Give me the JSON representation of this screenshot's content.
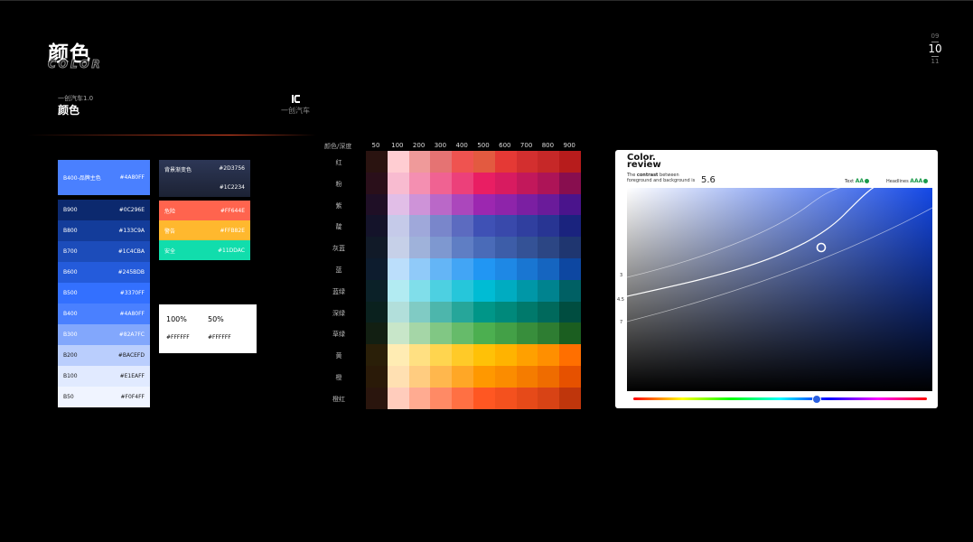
{
  "page": {
    "title_cn": "颜色",
    "title_en": "COLOR",
    "page_prev": "09",
    "page_current": "10",
    "page_next": "11"
  },
  "section": {
    "small_label": "一创汽车1.0",
    "big_label": "颜色",
    "logo_text": "一创汽车",
    "logo_icon": "ic-logo-mark"
  },
  "brand_swatch": {
    "name": "B400-品牌主色",
    "hex": "#4A80FF",
    "color": "#4A80FF"
  },
  "blue_scale": [
    {
      "name": "B900",
      "hex": "#0C296E",
      "color": "#0C296E"
    },
    {
      "name": "B800",
      "hex": "#133C9A",
      "color": "#133C9A"
    },
    {
      "name": "B700",
      "hex": "#1C4CBA",
      "color": "#1C4CBA"
    },
    {
      "name": "B600",
      "hex": "#245BDB",
      "color": "#245BDB"
    },
    {
      "name": "B500",
      "hex": "#3370FF",
      "color": "#3370FF"
    },
    {
      "name": "B400",
      "hex": "#4A80FF",
      "color": "#4A80FF"
    },
    {
      "name": "B300",
      "hex": "#82A7FC",
      "color": "#82A7FC"
    },
    {
      "name": "B200",
      "hex": "#BACEFD",
      "color": "#BACEFD"
    },
    {
      "name": "B100",
      "hex": "#E1EAFF",
      "color": "#E1EAFF"
    },
    {
      "name": "B50",
      "hex": "#F0F4FF",
      "color": "#F0F4FF"
    }
  ],
  "gradient_card": {
    "name": "背景渐变色",
    "hex_top": "#2D3756",
    "hex_bottom": "#1C2234"
  },
  "status_swatches": [
    {
      "name": "危险",
      "hex": "#FF644E",
      "color": "#FF644E"
    },
    {
      "name": "警告",
      "hex": "#FFB82E",
      "color": "#FFB82E"
    },
    {
      "name": "安全",
      "hex": "#11DDAC",
      "color": "#11DDAC"
    }
  ],
  "white_card": {
    "pct_a": "100%",
    "pct_b": "50%",
    "hex_a": "#FFFFFF",
    "hex_b": "#FFFFFF"
  },
  "palette": {
    "corner": "颜色/深度",
    "columns": [
      "50",
      "100",
      "200",
      "300",
      "400",
      "500",
      "600",
      "700",
      "800",
      "900"
    ],
    "rows": [
      {
        "name": "红",
        "colors": [
          "#2a1310",
          "#FFCDD2",
          "#EF9A9A",
          "#E57373",
          "#EF5350",
          "#E35A40",
          "#E53935",
          "#D32F2F",
          "#C62828",
          "#B71C1C"
        ]
      },
      {
        "name": "粉",
        "colors": [
          "#2a0f1a",
          "#F8BBD0",
          "#F48FB1",
          "#F06292",
          "#EC407A",
          "#E91E63",
          "#D81B60",
          "#C2185B",
          "#AD1457",
          "#880E4F"
        ]
      },
      {
        "name": "紫",
        "colors": [
          "#1f0f26",
          "#E1BEE7",
          "#CE93D8",
          "#BA68C8",
          "#AB47BC",
          "#9C27B0",
          "#8E24AA",
          "#7B1FA2",
          "#6A1B9A",
          "#4A148C"
        ]
      },
      {
        "name": "靛",
        "colors": [
          "#14132a",
          "#C5CAE9",
          "#9FA8DA",
          "#7986CB",
          "#5C6BC0",
          "#3F51B5",
          "#3949AB",
          "#303F9F",
          "#283593",
          "#1A237E"
        ]
      },
      {
        "name": "灰蓝",
        "colors": [
          "#111a28",
          "#C6D0E8",
          "#9FB2DA",
          "#7E98D0",
          "#5F7EC4",
          "#4A6BB8",
          "#3D5DA8",
          "#345296",
          "#2C4684",
          "#1F3670"
        ]
      },
      {
        "name": "蓝",
        "colors": [
          "#0d1c2e",
          "#BBDEFB",
          "#90CAF9",
          "#64B5F6",
          "#42A5F5",
          "#2196F3",
          "#1E88E5",
          "#1976D2",
          "#1565C0",
          "#0D47A1"
        ]
      },
      {
        "name": "蓝绿",
        "colors": [
          "#0b2128",
          "#B2EBF2",
          "#80DEEA",
          "#4DD0E1",
          "#26C6DA",
          "#00BCD4",
          "#00ACC1",
          "#0097A7",
          "#00838F",
          "#006064"
        ]
      },
      {
        "name": "深绿",
        "colors": [
          "#0a211e",
          "#B2DFDB",
          "#80CBC4",
          "#4DB6AC",
          "#26A69A",
          "#009688",
          "#00897B",
          "#00796B",
          "#00695C",
          "#004D40"
        ]
      },
      {
        "name": "草绿",
        "colors": [
          "#121f12",
          "#C8E6C9",
          "#A5D6A7",
          "#81C784",
          "#66BB6A",
          "#4CAF50",
          "#43A047",
          "#388E3C",
          "#2E7D32",
          "#1B5E20"
        ]
      },
      {
        "name": "黄",
        "colors": [
          "#2a1f08",
          "#FFECB3",
          "#FFE082",
          "#FFD54F",
          "#FFCA28",
          "#FFC107",
          "#FFB300",
          "#FFA000",
          "#FF8F00",
          "#FF6F00"
        ]
      },
      {
        "name": "橙",
        "colors": [
          "#2a1a08",
          "#FFE0B2",
          "#FFCC80",
          "#FFB74D",
          "#FFA726",
          "#FF9800",
          "#FB8C00",
          "#F57C00",
          "#EF6C00",
          "#E65100"
        ]
      },
      {
        "name": "橙红",
        "colors": [
          "#2a150d",
          "#FFCCBC",
          "#FFAB91",
          "#FF8A65",
          "#FF7043",
          "#FF5722",
          "#F4511E",
          "#E64A19",
          "#D84315",
          "#BF360C"
        ]
      }
    ]
  },
  "color_review": {
    "title_line1": "Color.",
    "title_line2": "review",
    "desc_pre": "The ",
    "desc_bold": "contrast",
    "desc_post": " between",
    "desc_line2": "foreground and background is",
    "ratio": "5.6",
    "text_label": "Text",
    "text_grade": "AA",
    "headline_label": "Headlines",
    "headline_grade": "AAA",
    "ticks": [
      "3",
      "4.5",
      "7"
    ],
    "check_icon": "check-circle-icon",
    "base_color": "#1448E6"
  }
}
